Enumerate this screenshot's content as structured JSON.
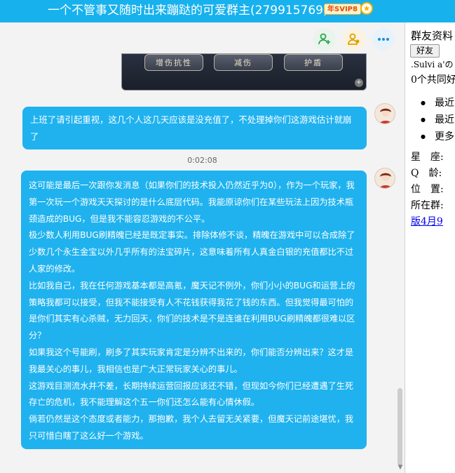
{
  "window": {
    "title": "一个不管事又随时出来蹦跶的可爱群主(279915769)",
    "vip_badge": "年SVIP8"
  },
  "toolbar": {
    "add_member_icon": "add-user-icon",
    "group_icon": "group-user-icon",
    "more_icon": "more-icon"
  },
  "game_screenshot": {
    "buttons": [
      "增伤抗性",
      "减伤",
      "护盾"
    ]
  },
  "messages": [
    {
      "text": "上班了请引起重视，这几个人这几天应该是没充值了，不处理掉你们这游戏估计就崩了"
    },
    {
      "paragraphs": [
        "这可能是最后一次跟你发消息（如果你们的技术投入仍然近乎为0），作为一个玩家，我第一次玩一个游戏天天探讨的是什么底层代码。我能原谅你们在某些玩法上因为技术瓶颈造成的BUG，但是我不能容忍游戏的不公平。",
        "极少数人利用BUG刷精魄已经是既定事实。排除体修不谈，精魄在游戏中可以合成除了少数几个永生金宝以外几乎所有的法宝碎片，这意味着所有人真金白银的充值都比不过人家的修改。",
        "比如我自己，我在任何游戏基本都是高氪，魔天记不例外，你们小小的BUG和运营上的策略我都可以接受，但我不能接受有人不花钱获得我花了钱的东西。但我觉得最可怕的是你们其实有心杀贼，无力回天，你们的技术是不是连谁在利用BUG刷精魄都很难以区分？",
        "如果我这个号能刷，刷多了其实玩家肯定是分辨不出来的，你们能否分辨出来？这才是我最关心的事儿，我相信也是广大正常玩家关心的事儿。",
        "这游戏目测流水并不差，长期持续运营回报应该还不错，但现如今你们已经遭遇了生死存亡的危机，我不能理解这个五一你们还怎么能有心情休假。",
        "倘若仍然是这个态度或者能力，那抱歉，我个人去留无关紧要，但魔天记前途堪忧，我只可惜白瞎了这么好一个游戏。"
      ]
    }
  ],
  "timestamp": "0:02:08",
  "sidebar": {
    "title": "群友资料",
    "friend_button": "好友",
    "name": ".Sulvi a'の",
    "common_groups": "0个共同好",
    "list": [
      "最近",
      "最近",
      "更多"
    ],
    "info": [
      {
        "label": "星　座:",
        "value": ""
      },
      {
        "label": "Q　龄:",
        "value": ""
      },
      {
        "label": "位　置:",
        "value": ""
      },
      {
        "label": "所在群:",
        "value": ""
      }
    ],
    "link": "版4月9"
  }
}
